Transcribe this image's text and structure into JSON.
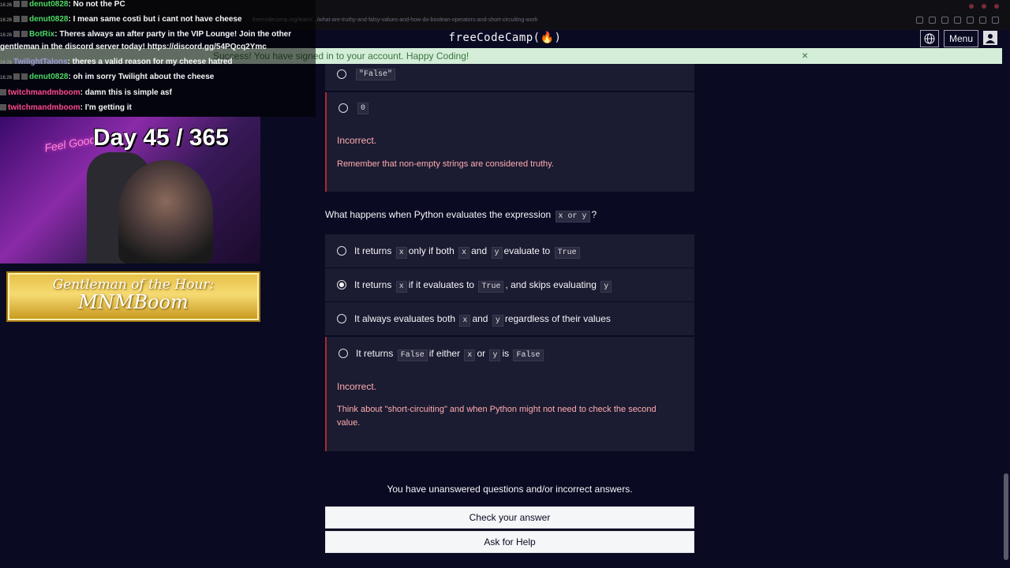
{
  "browser": {
    "url": "freecodecamp.org/learn/.../what-are-truthy-and-falsy-values-and-how-do-boolean-operators-and-short-circuiting-work"
  },
  "nav": {
    "logo": "freeCodeCamp(🔥)",
    "menu_label": "Menu"
  },
  "flash": {
    "message": "Success! You have signed in to your account. Happy Coding!",
    "close": "×"
  },
  "prev_question": {
    "options": [
      "\"False\"",
      "0"
    ],
    "feedback": "Incorrect.",
    "hint": "Remember that non-empty strings are considered truthy."
  },
  "question": {
    "prefix": "What happens when Python evaluates the expression",
    "code": "x or y",
    "suffix": "?",
    "opt1": {
      "t1": "It returns",
      "c1": "x",
      "t2": "only if both",
      "c2": "x",
      "t3": "and",
      "c3": "y",
      "t4": "evaluate to",
      "c4": "True"
    },
    "opt2": {
      "t1": "It returns",
      "c1": "x",
      "t2": "if it evaluates to",
      "c2": "True",
      "t3": ", and skips evaluating",
      "c3": "y"
    },
    "opt3": {
      "t1": "It always evaluates both",
      "c1": "x",
      "t2": "and",
      "c2": "y",
      "t3": "regardless of their values"
    },
    "opt4": {
      "t1": "It returns",
      "c1": "False",
      "t2": "if either",
      "c2": "x",
      "t3": "or",
      "c3": "y",
      "t4": "is",
      "c4": "False"
    },
    "feedback": "Incorrect.",
    "hint": "Think about \"short-circuiting\" and when Python might not need to check the second value."
  },
  "status": "You have unanswered questions and/or incorrect answers.",
  "buttons": {
    "check": "Check your answer",
    "help": "Ask for Help"
  },
  "overlay": {
    "chat": [
      {
        "time": "16:26",
        "user": "denut0828",
        "user_color": "#4cd964",
        "msg": ": No not the PC"
      },
      {
        "time": "16:26",
        "user": "denut0828",
        "user_color": "#4cd964",
        "msg": ": I mean same costi but i cant not have cheese"
      },
      {
        "time": "16:26",
        "user": "BotRix",
        "user_color": "#4cd964",
        "msg": ": Theres always an after party in the VIP Lounge! Join the other"
      },
      {
        "time": "",
        "user": "",
        "user_color": "#f5f6f7",
        "msg": "gentleman in the discord server today! https://discord.gg/54PQcq2Ymc"
      },
      {
        "time": "16:26",
        "user": "TwilightTalons",
        "user_color": "#9a9ad8",
        "msg": ": theres a valid reason for my cheese hatred"
      },
      {
        "time": "16:26",
        "user": "denut0828",
        "user_color": "#4cd964",
        "msg": ": oh im sorry Twilight about the cheese"
      },
      {
        "time": "",
        "user": "twitchmandmboom",
        "user_color": "#ff4a8a",
        "msg": ": damn this is simple asf"
      },
      {
        "time": "",
        "user": "twitchmandmboom",
        "user_color": "#ff4a8a",
        "msg": ": I'm getting it"
      }
    ],
    "day_counter": "Day 45 / 365",
    "neon_sign": "Feel Good",
    "banner_line1": "Gentleman of the Hour:",
    "banner_line2": "MNMBoom"
  }
}
